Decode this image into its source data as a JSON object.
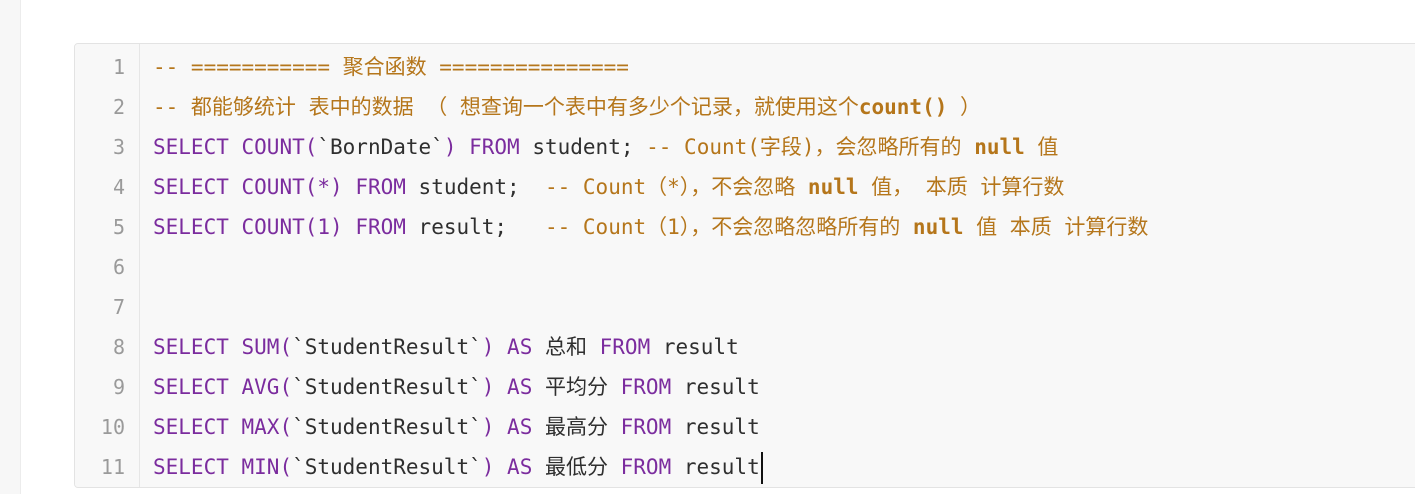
{
  "editor": {
    "line_numbers": [
      "1",
      "2",
      "3",
      "4",
      "5",
      "6",
      "7",
      "8",
      "9",
      "10",
      "11"
    ],
    "lines": {
      "l1": {
        "comment": "-- =========== 聚合函数 ==============="
      },
      "l2": {
        "comment_a": "-- 都能够统计 表中的数据 （ 想查询一个表中有多少个记录，就使用这个",
        "comment_b": "count()",
        "comment_c": " ）"
      },
      "l3": {
        "kw1": "SELECT",
        "t1": " ",
        "kw2": "COUNT(",
        "t2": "`BornDate`",
        "kw3": ") ",
        "kw4": "FROM",
        "t3": " student; ",
        "comment": "-- Count(字段)，会忽略所有的 ",
        "comment_b": "null",
        "comment_c": " 值"
      },
      "l4": {
        "kw1": "SELECT",
        "t1": " ",
        "kw2": "COUNT(*)",
        "t2": " ",
        "kw3": "FROM",
        "t3": " student;  ",
        "comment": "-- Count（*），不会忽略 ",
        "comment_b": "null",
        "comment_c": " 值， 本质 计算行数"
      },
      "l5": {
        "kw1": "SELECT",
        "t1": " ",
        "kw2": "COUNT(1)",
        "t2": " ",
        "kw3": "FROM",
        "t3": " result;   ",
        "comment": "-- Count（1），不会忽略忽略所有的 ",
        "comment_b": "null",
        "comment_c": " 值 本质 计算行数"
      },
      "l8": {
        "kw1": "SELECT",
        "t1": " ",
        "kw2": "SUM(",
        "t2": "`StudentResult`",
        "kw3": ") ",
        "kw4": "AS",
        "t3": " 总和 ",
        "kw5": "FROM",
        "t4": " result"
      },
      "l9": {
        "kw1": "SELECT",
        "t1": " ",
        "kw2": "AVG(",
        "t2": "`StudentResult`",
        "kw3": ") ",
        "kw4": "AS",
        "t3": " 平均分 ",
        "kw5": "FROM",
        "t4": " result"
      },
      "l10": {
        "kw1": "SELECT",
        "t1": " ",
        "kw2": "MAX(",
        "t2": "`StudentResult`",
        "kw3": ") ",
        "kw4": "AS",
        "t3": " 最高分 ",
        "kw5": "FROM",
        "t4": " result"
      },
      "l11": {
        "kw1": "SELECT",
        "t1": " ",
        "kw2": "MIN(",
        "t2": "`StudentResult`",
        "kw3": ") ",
        "kw4": "AS",
        "t3": " 最低分 ",
        "kw5": "FROM",
        "t4": " result"
      }
    }
  },
  "colors": {
    "keyword": "#7b2c9e",
    "comment": "#b5761b",
    "text": "#2f2f2f",
    "line_number": "#9a9a9a"
  }
}
